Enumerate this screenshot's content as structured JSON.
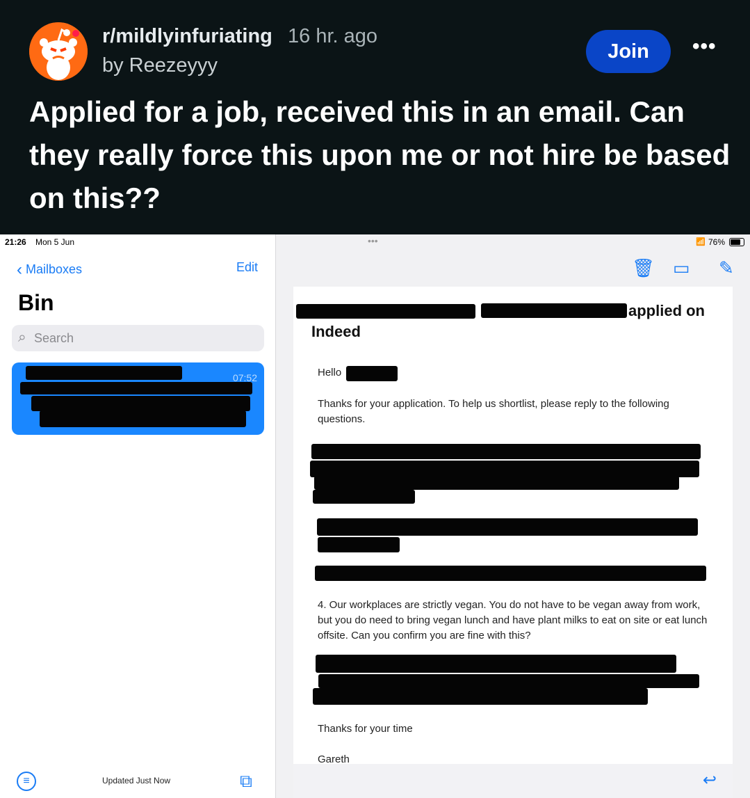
{
  "post": {
    "subreddit": "r/mildlyinfuriating",
    "age": "16 hr. ago",
    "author": "by Reezeyyy",
    "join_label": "Join",
    "more_label": "•••",
    "title": "Applied for a job, received this in an email. Can they really force this upon me or not hire be based on this??"
  },
  "status_bar": {
    "time": "21:26",
    "date": "Mon 5 Jun",
    "battery": "76%"
  },
  "mailbox": {
    "back_label": "Mailboxes",
    "edit_label": "Edit",
    "title": "Bin",
    "search_placeholder": "Search",
    "item_time": "07:52",
    "footer_status": "Updated Just Now"
  },
  "email": {
    "subject_tail": "applied on",
    "subject_line2": "Indeed",
    "greeting": "Hello",
    "intro": "Thanks for your application. To help us shortlist, please reply to the following questions.",
    "question4": "4. Our workplaces are strictly vegan. You do not have to be vegan away from work, but you do need to bring vegan lunch and have plant milks to eat on site or eat lunch offsite. Can you confirm you are fine with this?",
    "thanks": "Thanks for your time",
    "signature": "Gareth"
  },
  "colors": {
    "reddit_bg": "#0b1416",
    "join_blue": "#0a45c7",
    "ios_blue": "#1a7cf5",
    "selected_mail": "#1a87ff",
    "snoo_orange": "#ff6a13"
  },
  "icons": [
    "snoo-avatar-icon",
    "chevron-left-icon",
    "search-icon",
    "trash-icon",
    "folder-icon",
    "compose-icon",
    "filter-icon",
    "copy-icon",
    "reply-icon",
    "wifi-icon",
    "battery-icon"
  ]
}
